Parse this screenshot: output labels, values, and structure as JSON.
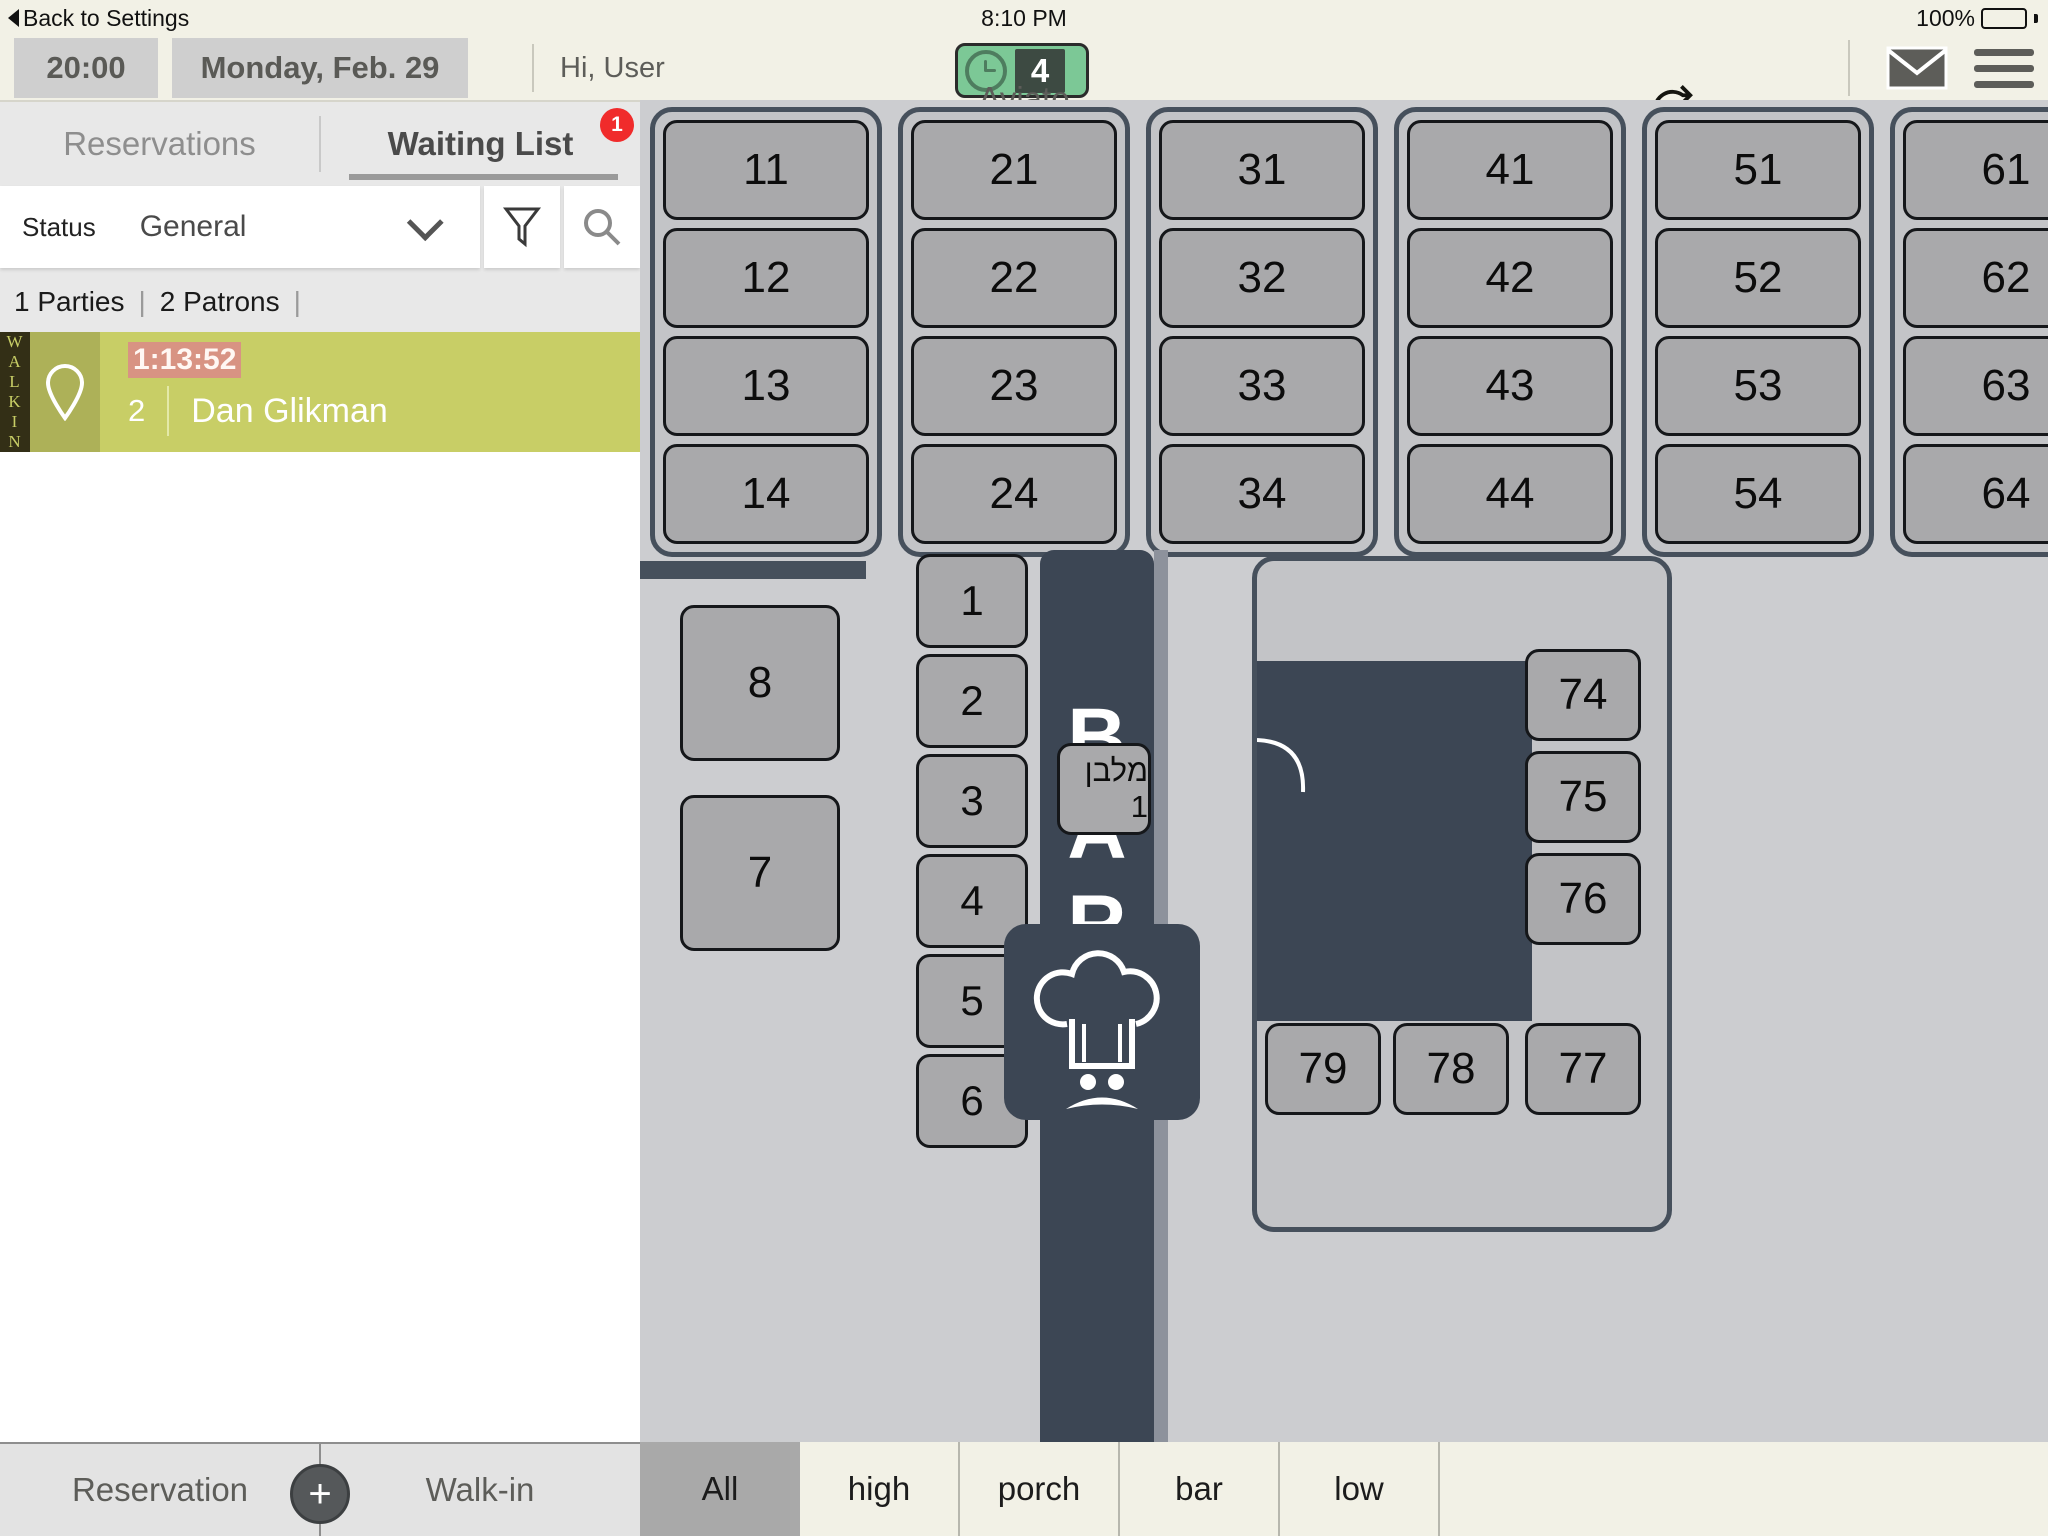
{
  "statusbar": {
    "back_label": "Back to Settings",
    "time": "8:10 PM",
    "battery_percent": "100%"
  },
  "header": {
    "time_pill": "20:00",
    "date_pill": "Monday, Feb. 29",
    "greeting": "Hi, User",
    "clock_badge_count": "4",
    "venue": "Aviato",
    "sync_icon": "refresh-icon",
    "mail_icon": "envelope-icon",
    "menu_icon": "hamburger-menu-icon"
  },
  "left_panel": {
    "tabs": [
      {
        "label": "Reservations",
        "active": false,
        "badge": ""
      },
      {
        "label": "Waiting List",
        "active": true,
        "badge": "1"
      }
    ],
    "filter": {
      "status_label": "Status",
      "status_value": "General",
      "chevron_icon": "chevron-down-icon",
      "filter_icon": "funnel-filter-icon",
      "search_icon": "search-icon"
    },
    "summary": {
      "parties": "1 Parties",
      "patrons": "2 Patrons"
    },
    "waiting_list": [
      {
        "tag": "WALKIN",
        "pin_icon": "location-pin-icon",
        "timer": "1:13:52",
        "party_size": "2",
        "name": "Dan Glikman"
      }
    ]
  },
  "floor_plan": {
    "top_groups": [
      {
        "tables": [
          "11",
          "12",
          "13",
          "14"
        ]
      },
      {
        "tables": [
          "21",
          "22",
          "23",
          "24"
        ]
      },
      {
        "tables": [
          "31",
          "32",
          "33",
          "34"
        ]
      },
      {
        "tables": [
          "41",
          "42",
          "43",
          "44"
        ]
      },
      {
        "tables": [
          "51",
          "52",
          "53",
          "54"
        ]
      },
      {
        "tables": [
          "61",
          "62",
          "63",
          "64"
        ]
      }
    ],
    "left_tables": [
      "8",
      "7"
    ],
    "bar_column_tables": [
      "1",
      "2",
      "3",
      "4",
      "5",
      "6"
    ],
    "bar_label": "BAR",
    "rect_table": "מלבן 1",
    "chef_icon": "chef-hat-icon",
    "right_room": {
      "tables_right": [
        "74",
        "75",
        "76"
      ],
      "tables_bottom": [
        "79",
        "78",
        "77"
      ]
    }
  },
  "bottom_bar": {
    "reservation_label": "Reservation",
    "add_icon": "plus-icon",
    "walkin_label": "Walk-in",
    "zones": [
      {
        "label": "All",
        "active": true
      },
      {
        "label": "high",
        "active": false
      },
      {
        "label": "porch",
        "active": false
      },
      {
        "label": "bar",
        "active": false
      },
      {
        "label": "low",
        "active": false
      }
    ]
  },
  "colors": {
    "accent_green": "#7cc896",
    "badge_red": "#f02b2b",
    "walkin_row": "#c8ce66",
    "timer_bg": "#d89383",
    "dark_slate": "#3c4654"
  }
}
